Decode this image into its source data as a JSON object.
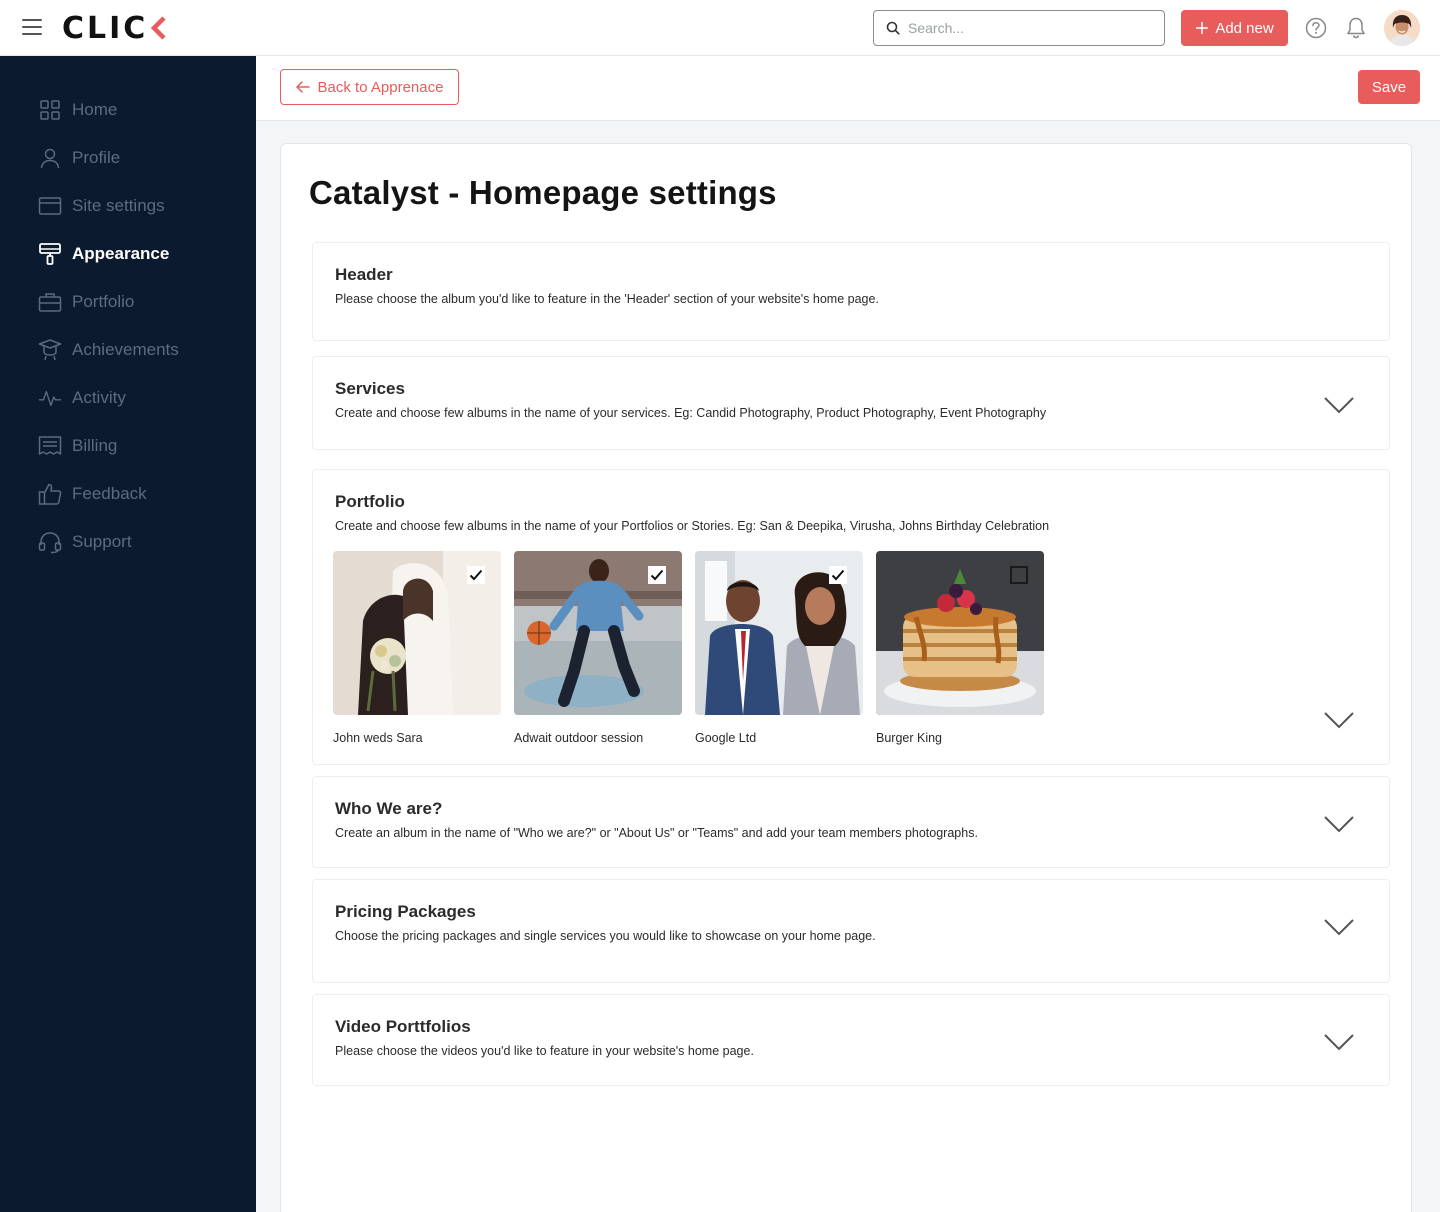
{
  "topbar": {
    "logo_text": "CLIC",
    "search_placeholder": "Search...",
    "add_new_label": "Add new"
  },
  "sidebar": {
    "items": [
      {
        "label": "Home",
        "icon": "grid-icon"
      },
      {
        "label": "Profile",
        "icon": "user-icon"
      },
      {
        "label": "Site settings",
        "icon": "window-icon"
      },
      {
        "label": "Appearance",
        "icon": "paint-roller-icon",
        "active": true
      },
      {
        "label": "Portfolio",
        "icon": "briefcase-icon"
      },
      {
        "label": "Achievements",
        "icon": "graduation-cap-icon"
      },
      {
        "label": "Activity",
        "icon": "pulse-icon"
      },
      {
        "label": "Billing",
        "icon": "receipt-icon"
      },
      {
        "label": "Feedback",
        "icon": "thumbs-up-icon"
      },
      {
        "label": "Support",
        "icon": "headset-icon"
      }
    ]
  },
  "actionbar": {
    "back_label": "Back to Apprenace",
    "save_label": "Save"
  },
  "page": {
    "title": "Catalyst - Homepage settings"
  },
  "sections": {
    "header": {
      "title": "Header",
      "desc": "Please choose the album you'd like to feature in the 'Header' section of your website's home page."
    },
    "services": {
      "title": "Services",
      "desc": "Create and choose few albums in the name of your services. Eg: Candid Photography, Product Photography, Event Photography"
    },
    "portfolio": {
      "title": "Portfolio",
      "desc": "Create and choose few albums in the name of your Portfolios or Stories. Eg: San & Deepika, Virusha, Johns Birthday Celebration",
      "albums": [
        {
          "name": "John weds Sara",
          "checked": true
        },
        {
          "name": "Adwait outdoor session",
          "checked": true
        },
        {
          "name": "Google Ltd",
          "checked": true
        },
        {
          "name": "Burger King",
          "checked": false
        }
      ]
    },
    "who": {
      "title": "Who We are?",
      "desc": "Create an album in the name of \"Who we are?\" or \"About Us\" or \"Teams\" and add your team members photographs."
    },
    "pricing": {
      "title": "Pricing Packages",
      "desc": "Choose the pricing packages and single services you would like to showcase on your home page."
    },
    "video": {
      "title": "Video Porttfolios",
      "desc": "Please choose the videos you'd like to feature in your website's home page."
    }
  },
  "colors": {
    "accent": "#e85c5c",
    "sidebar_bg": "#0b1a2f",
    "sidebar_text": "#5d6b80"
  }
}
